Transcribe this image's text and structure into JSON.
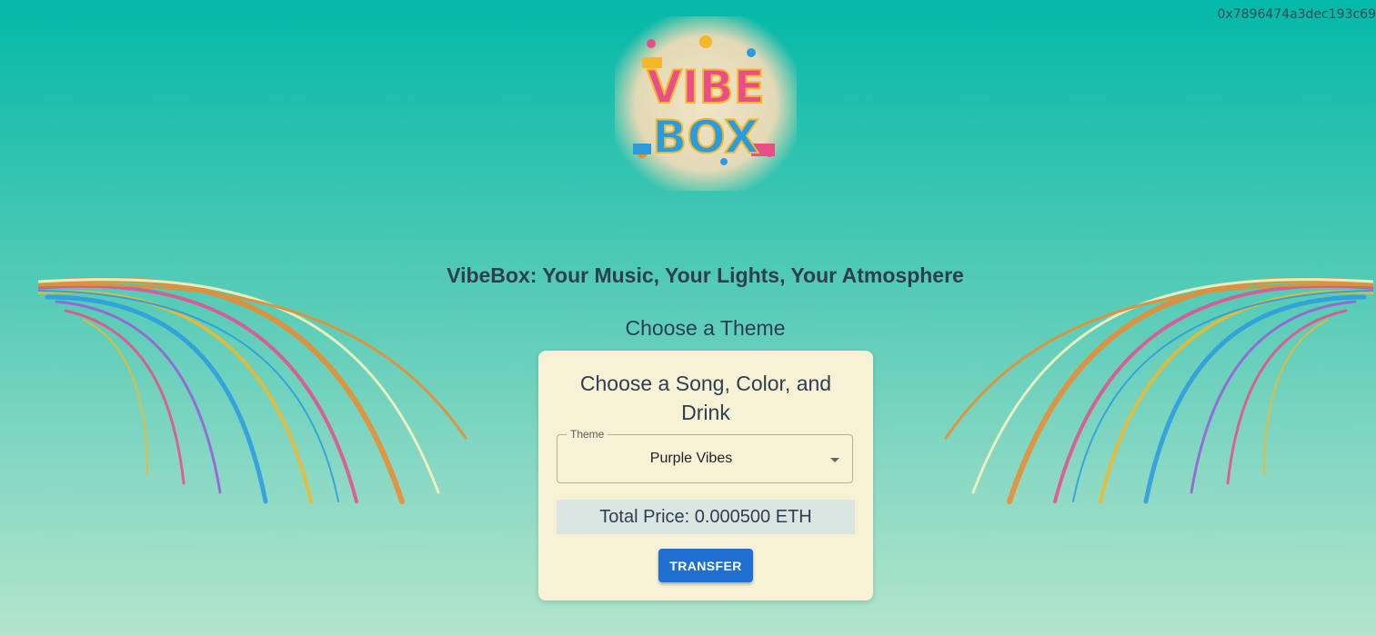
{
  "header": {
    "wallet_address": "0x7896474a3dec193c69"
  },
  "logo": {
    "icon": "vibebox-logo",
    "line1": "VIBE",
    "line2": "BOX"
  },
  "main": {
    "headline": "VibeBox: Your Music, Your Lights, Your Atmosphere",
    "subhead": "Choose a Theme"
  },
  "card": {
    "title": "Choose a Song, Color, and Drink",
    "theme_select": {
      "label": "Theme",
      "value": "Purple Vibes"
    },
    "total_price": "Total Price: 0.000500 ETH",
    "transfer_label": "TRANSFER"
  },
  "colors": {
    "background_top": "#04b8a8",
    "background_bottom": "#b2e5cb",
    "card_bg": "#f7f2d6",
    "price_bg": "#dbe6e3",
    "button": "#1f6fd1",
    "text": "#2c3e50"
  }
}
